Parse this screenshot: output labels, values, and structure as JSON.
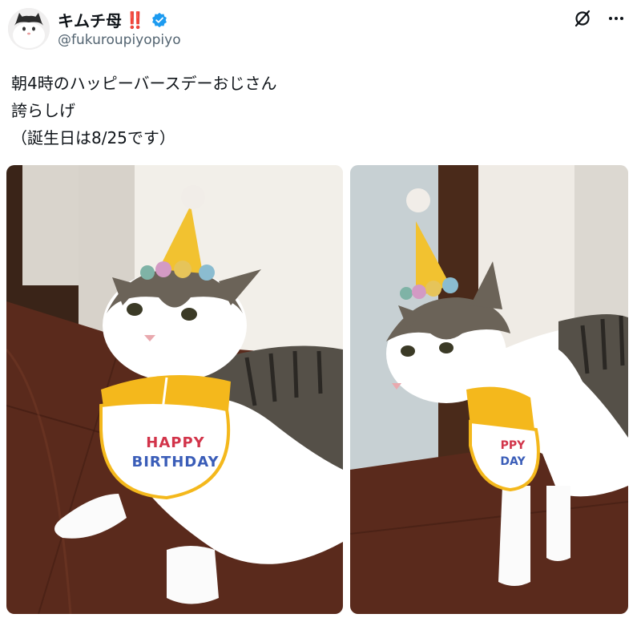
{
  "author": {
    "display_name": "キムチ母",
    "emphasis": "‼️",
    "handle": "@fukuroupiyopiyo",
    "verified": true,
    "avatar": "cat-avatar"
  },
  "header_icons": [
    "grok-icon",
    "more-icon"
  ],
  "tweet": {
    "lines": [
      "朝4時のハッピーバースデーおじさん",
      "誇らしげ",
      "（誕生日は8/25です）"
    ]
  },
  "media": {
    "left_bib_text_line1": "HAPPY",
    "left_bib_text_line2": "BIRTHDAY",
    "right_bib_text_line1": "PPY",
    "right_bib_text_line2": "DAY"
  },
  "colors": {
    "verified_blue": "#1d9bf0",
    "exclamation": "#e0245e",
    "floor": "#5a2a1c",
    "hat_yellow": "#f2c230",
    "bib_yellow": "#f4b81c"
  }
}
